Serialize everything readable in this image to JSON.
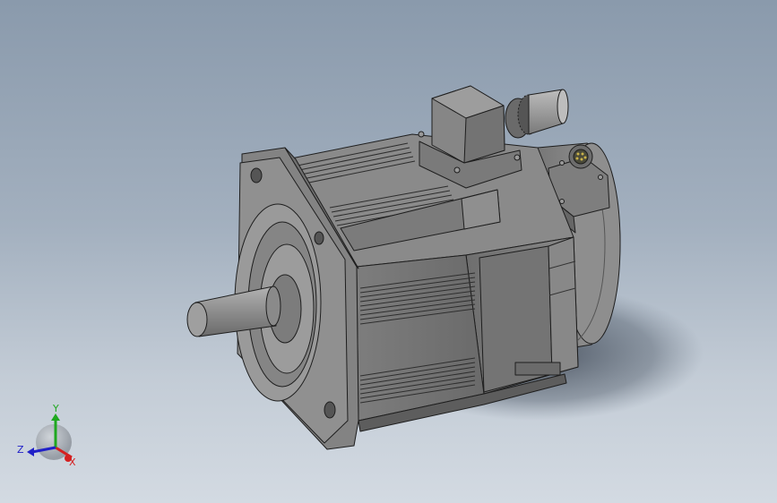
{
  "viewport": {
    "background_top": "#8a9aac",
    "background_bottom": "#d3dae2",
    "model": "servo-motor"
  },
  "triad": {
    "x_label": "X",
    "y_label": "Y",
    "z_label": "Z",
    "x_color": "#d42020",
    "y_color": "#1fa81f",
    "z_color": "#2020c8"
  }
}
